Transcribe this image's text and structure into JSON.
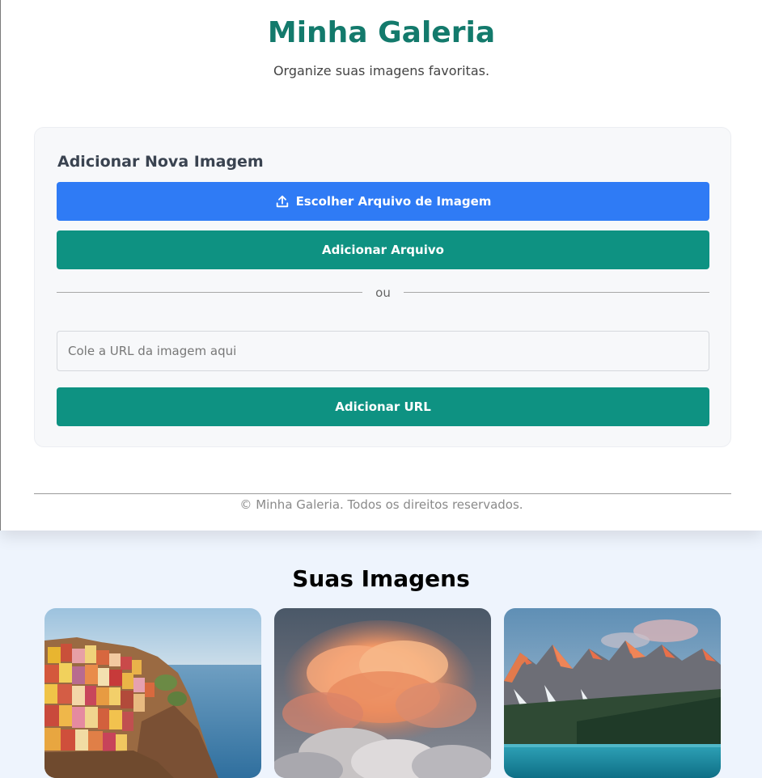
{
  "header": {
    "title": "Minha Galeria",
    "subtitle": "Organize suas imagens favoritas."
  },
  "upload_panel": {
    "title": "Adicionar Nova Imagem",
    "choose_file_label": "Escolher Arquivo de Imagem",
    "choose_file_icon": "upload-icon",
    "add_file_label": "Adicionar Arquivo",
    "divider_text": "ou",
    "url_placeholder": "Cole a URL da imagem aqui",
    "url_value": "",
    "add_url_label": "Adicionar URL"
  },
  "footer": {
    "text": "© Minha Galeria. Todos os direitos reservados."
  },
  "gallery": {
    "title": "Suas Imagens",
    "images": [
      {
        "subject": "colorful-cliffside-village"
      },
      {
        "subject": "sunset-clouds"
      },
      {
        "subject": "mountain-lake"
      }
    ]
  },
  "colors": {
    "title_green": "#137a6c",
    "primary_blue": "#2f7bf5",
    "action_teal": "#0e9282",
    "page_background": "#eef4fd"
  }
}
